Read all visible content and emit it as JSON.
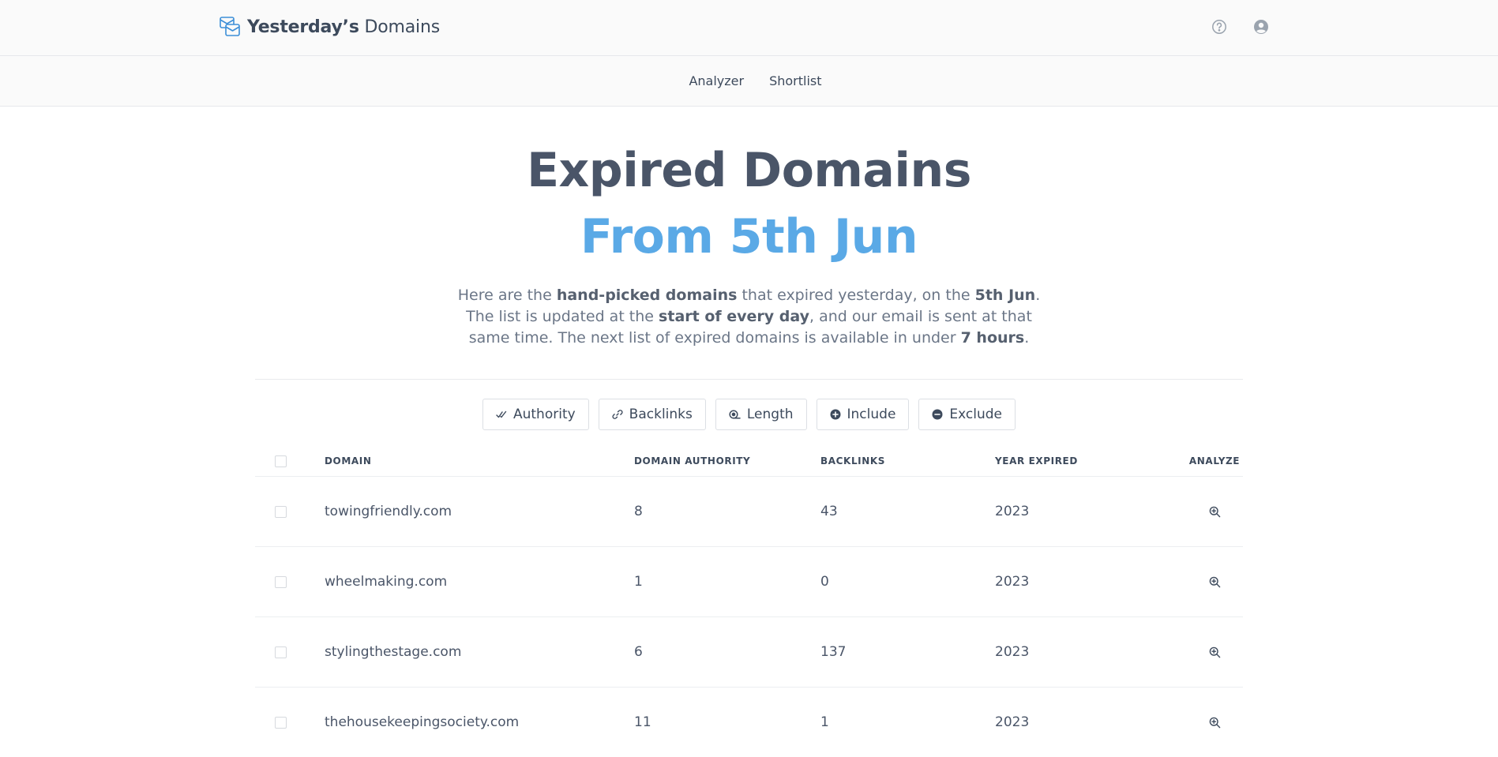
{
  "brand": {
    "name_bold": "Yesterday’s",
    "name_rest": " Domains",
    "icon": "mail-stack-icon"
  },
  "top_icons": [
    "help-icon",
    "account-icon"
  ],
  "nav": {
    "items": [
      {
        "label": "Analyzer"
      },
      {
        "label": "Shortlist"
      }
    ]
  },
  "hero": {
    "title_line1": "Expired Domains",
    "title_line2": "From 5th Jun",
    "intro": {
      "p1": "Here are the ",
      "b1": "hand-picked domains",
      "p2": " that expired yesterday, on the ",
      "b2": "5th Jun",
      "p3": ". The list is updated at the ",
      "b3": "start of every day",
      "p4": ", and our email is sent at that same time. The next list of expired domains is available in under ",
      "b4": "7 hours",
      "p5": "."
    }
  },
  "filters": [
    {
      "label": "Authority",
      "icon": "double-check-icon"
    },
    {
      "label": "Backlinks",
      "icon": "link-icon"
    },
    {
      "label": "Length",
      "icon": "ruler-tape-icon"
    },
    {
      "label": "Include",
      "icon": "plus-circle-icon"
    },
    {
      "label": "Exclude",
      "icon": "minus-circle-icon"
    }
  ],
  "table": {
    "headers": {
      "domain": "DOMAIN",
      "authority": "DOMAIN AUTHORITY",
      "backlinks": "BACKLINKS",
      "year": "YEAR EXPIRED",
      "analyze": "ANALYZE"
    },
    "rows": [
      {
        "domain": "towingfriendly.com",
        "authority": "8",
        "backlinks": "43",
        "year": "2023"
      },
      {
        "domain": "wheelmaking.com",
        "authority": "1",
        "backlinks": "0",
        "year": "2023"
      },
      {
        "domain": "stylingthestage.com",
        "authority": "6",
        "backlinks": "137",
        "year": "2023"
      },
      {
        "domain": "thehousekeepingsociety.com",
        "authority": "11",
        "backlinks": "1",
        "year": "2023"
      }
    ]
  },
  "colors": {
    "accent": "#5aa9e6",
    "highlight": "#bfe0f8",
    "text": "#4a5568"
  }
}
